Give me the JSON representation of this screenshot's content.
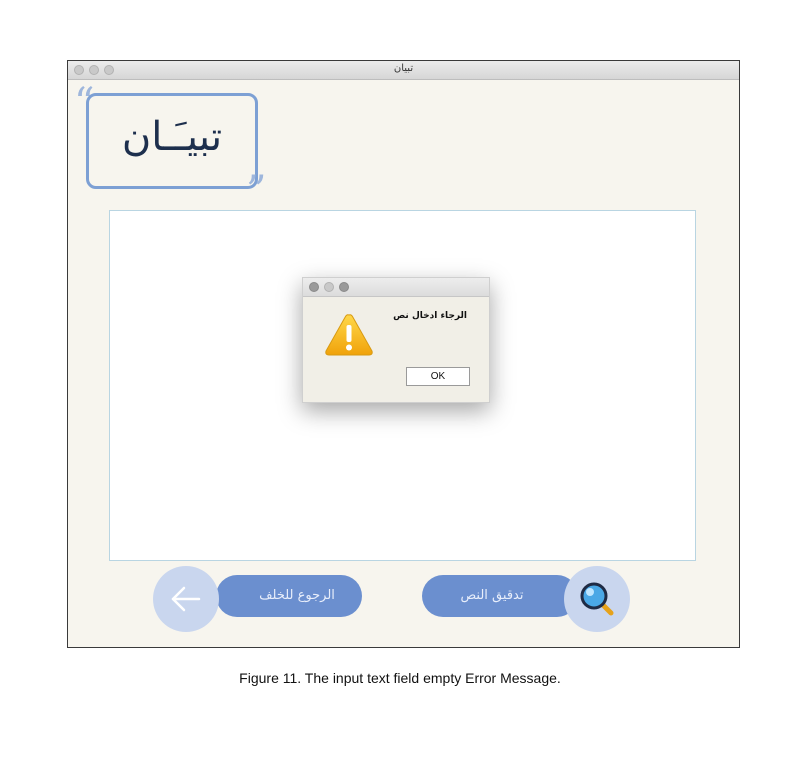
{
  "window": {
    "title": "تبيان"
  },
  "logo": {
    "text": "تبيـَـان",
    "quote_open": "“",
    "quote_close": "”"
  },
  "dialog": {
    "message": "الرجاء ادخال نص",
    "ok_label": "OK"
  },
  "buttons": {
    "back_label": "الرجوع للخلف",
    "check_label": "تدقيق النص"
  },
  "caption": "Figure 11. The input text field empty Error Message.",
  "colors": {
    "accent": "#6b8fcf",
    "accent_light": "#c9d6ee",
    "logo_border": "#7da0d4"
  },
  "icons": {
    "back": "arrow-left-icon",
    "check": "magnifier-icon",
    "warning": "warning-icon"
  }
}
